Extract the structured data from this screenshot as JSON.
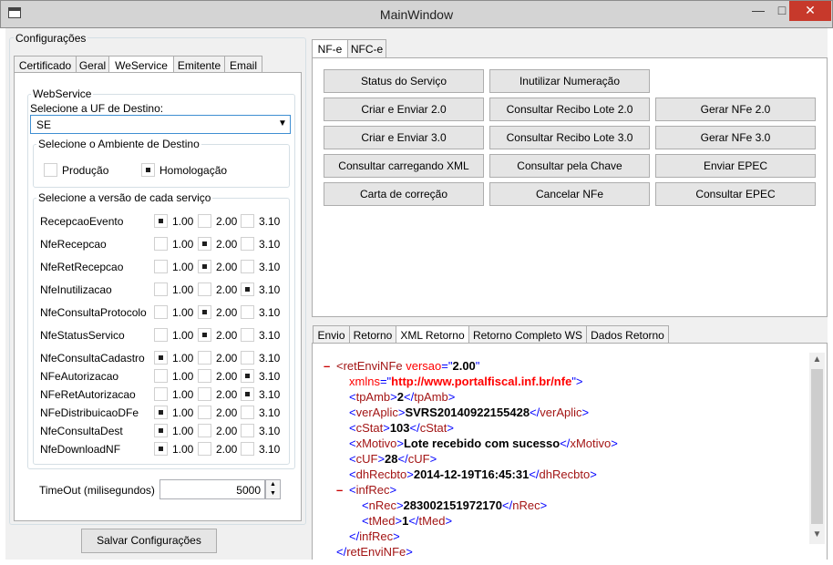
{
  "window": {
    "title": "MainWindow",
    "icon": "window-icon",
    "min": "—",
    "max": "□",
    "close": "✕"
  },
  "left": {
    "group_title": "Configurações",
    "tabs": [
      "Certificado",
      "Geral",
      "WeService",
      "Emitente",
      "Email"
    ],
    "webservice": {
      "group_title": "WebService",
      "uf_label": "Selecione a UF de Destino:",
      "uf_value": "SE",
      "ambiente": {
        "title": "Selecione o Ambiente de Destino",
        "options": [
          {
            "label": "Produção",
            "checked": false
          },
          {
            "label": "Homologação",
            "checked": true
          }
        ]
      },
      "versao": {
        "title": "Selecione a versão de cada serviço",
        "versions": [
          "1.00",
          "2.00",
          "3.10"
        ],
        "services": [
          {
            "name": "RecepcaoEvento",
            "selected": 0
          },
          {
            "name": "NfeRecepcao",
            "selected": 1
          },
          {
            "name": "NfeRetRecepcao",
            "selected": 1
          },
          {
            "name": "NfeInutilizacao",
            "selected": 2
          },
          {
            "name": "NfeConsultaProtocolo",
            "selected": 1
          },
          {
            "name": "NfeStatusServico",
            "selected": 1
          },
          {
            "name": "NfeConsultaCadastro",
            "selected": 0
          },
          {
            "name": "NFeAutorizacao",
            "selected": 2
          },
          {
            "name": "NFeRetAutorizacao",
            "selected": 2
          },
          {
            "name": "NFeDistribuicaoDFe",
            "selected": 0
          },
          {
            "name": "NfeConsultaDest",
            "selected": 0
          },
          {
            "name": "NfeDownloadNF",
            "selected": 0
          }
        ]
      },
      "timeout_label": "TimeOut (milisegundos)",
      "timeout_value": "5000"
    },
    "save_button": "Salvar Configurações"
  },
  "right": {
    "tabs": [
      "NF-e",
      "NFC-e"
    ],
    "buttons": [
      [
        "Status do Serviço",
        "Inutilizar Numeração",
        ""
      ],
      [
        "Criar e Enviar 2.0",
        "Consultar Recibo Lote 2.0",
        "Gerar NFe 2.0"
      ],
      [
        "Criar e Enviar 3.0",
        "Consultar Recibo Lote 3.0",
        "Gerar NFe 3.0"
      ],
      [
        "Consultar carregando XML",
        "Consultar pela Chave",
        "Enviar EPEC"
      ],
      [
        "Carta de correção",
        "Cancelar NFe",
        "Consultar EPEC"
      ]
    ],
    "result_tabs": [
      "Envio",
      "Retorno",
      "XML Retorno",
      "Retorno Completo WS",
      "Dados Retorno"
    ],
    "xml_lines": [
      {
        "indent": 0,
        "toggle": "–",
        "parts": [
          [
            "t",
            "<retEnviNFe"
          ],
          [
            "a",
            " versao"
          ],
          [
            "b",
            "=\""
          ],
          [
            "tx",
            "2.00"
          ],
          [
            "b",
            "\""
          ]
        ]
      },
      {
        "indent": 1,
        "toggle": "",
        "parts": [
          [
            "a",
            "xmlns"
          ],
          [
            "b",
            "=\""
          ],
          [
            "v2",
            "http://www.portalfiscal.inf.br/nfe"
          ],
          [
            "b",
            "\">"
          ]
        ]
      },
      {
        "indent": 1,
        "toggle": "",
        "parts": [
          [
            "b",
            "<"
          ],
          [
            "t",
            "tpAmb"
          ],
          [
            "b",
            ">"
          ],
          [
            "tx",
            "2"
          ],
          [
            "b",
            "</"
          ],
          [
            "t",
            "tpAmb"
          ],
          [
            "b",
            ">"
          ]
        ]
      },
      {
        "indent": 1,
        "toggle": "",
        "parts": [
          [
            "b",
            "<"
          ],
          [
            "t",
            "verAplic"
          ],
          [
            "b",
            ">"
          ],
          [
            "tx",
            "SVRS20140922155428"
          ],
          [
            "b",
            "</"
          ],
          [
            "t",
            "verAplic"
          ],
          [
            "b",
            ">"
          ]
        ]
      },
      {
        "indent": 1,
        "toggle": "",
        "parts": [
          [
            "b",
            "<"
          ],
          [
            "t",
            "cStat"
          ],
          [
            "b",
            ">"
          ],
          [
            "tx",
            "103"
          ],
          [
            "b",
            "</"
          ],
          [
            "t",
            "cStat"
          ],
          [
            "b",
            ">"
          ]
        ]
      },
      {
        "indent": 1,
        "toggle": "",
        "parts": [
          [
            "b",
            "<"
          ],
          [
            "t",
            "xMotivo"
          ],
          [
            "b",
            ">"
          ],
          [
            "tx",
            "Lote recebido com sucesso"
          ],
          [
            "b",
            "</"
          ],
          [
            "t",
            "xMotivo"
          ],
          [
            "b",
            ">"
          ]
        ]
      },
      {
        "indent": 1,
        "toggle": "",
        "parts": [
          [
            "b",
            "<"
          ],
          [
            "t",
            "cUF"
          ],
          [
            "b",
            ">"
          ],
          [
            "tx",
            "28"
          ],
          [
            "b",
            "</"
          ],
          [
            "t",
            "cUF"
          ],
          [
            "b",
            ">"
          ]
        ]
      },
      {
        "indent": 1,
        "toggle": "",
        "parts": [
          [
            "b",
            "<"
          ],
          [
            "t",
            "dhRecbto"
          ],
          [
            "b",
            ">"
          ],
          [
            "tx",
            "2014-12-19T16:45:31"
          ],
          [
            "b",
            "</"
          ],
          [
            "t",
            "dhRecbto"
          ],
          [
            "b",
            ">"
          ]
        ]
      },
      {
        "indent": 1,
        "toggle": "–",
        "parts": [
          [
            "b",
            "<"
          ],
          [
            "t",
            "infRec"
          ],
          [
            "b",
            ">"
          ]
        ]
      },
      {
        "indent": 2,
        "toggle": "",
        "parts": [
          [
            "b",
            "<"
          ],
          [
            "t",
            "nRec"
          ],
          [
            "b",
            ">"
          ],
          [
            "tx",
            "283002151972170"
          ],
          [
            "b",
            "</"
          ],
          [
            "t",
            "nRec"
          ],
          [
            "b",
            ">"
          ]
        ]
      },
      {
        "indent": 2,
        "toggle": "",
        "parts": [
          [
            "b",
            "<"
          ],
          [
            "t",
            "tMed"
          ],
          [
            "b",
            ">"
          ],
          [
            "tx",
            "1"
          ],
          [
            "b",
            "</"
          ],
          [
            "t",
            "tMed"
          ],
          [
            "b",
            ">"
          ]
        ]
      },
      {
        "indent": 1,
        "toggle": "",
        "parts": [
          [
            "b",
            "</"
          ],
          [
            "t",
            "infRec"
          ],
          [
            "b",
            ">"
          ]
        ]
      },
      {
        "indent": 0,
        "toggle": "",
        "parts": [
          [
            "b",
            "</"
          ],
          [
            "t",
            "retEnviNFe"
          ],
          [
            "b",
            ">"
          ]
        ]
      }
    ]
  }
}
